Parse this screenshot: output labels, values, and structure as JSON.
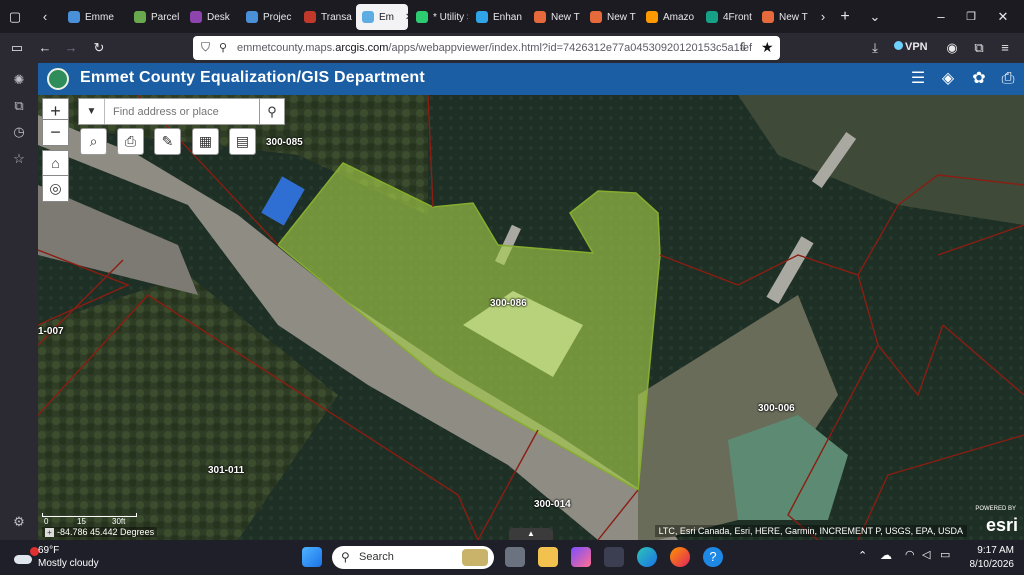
{
  "browser": {
    "tabs": [
      {
        "label": "Emme",
        "color": "#4a90d9"
      },
      {
        "label": "Parcel",
        "color": "#6aa84f"
      },
      {
        "label": "Desk",
        "color": "#8e44ad"
      },
      {
        "label": "Projec",
        "color": "#4a90d9"
      },
      {
        "label": "Transa",
        "color": "#c0392b"
      },
      {
        "label": "Em",
        "color": "#5dade2"
      },
      {
        "label": "* Utility Sh",
        "color": "#2ecc71"
      },
      {
        "label": "Enhan",
        "color": "#2fa4e7"
      },
      {
        "label": "New T",
        "color": "#e66a3c"
      },
      {
        "label": "New T",
        "color": "#e66a3c"
      },
      {
        "label": "Amazo",
        "color": "#ff9900"
      },
      {
        "label": "4Front",
        "color": "#16a085"
      },
      {
        "label": "New T",
        "color": "#e66a3c"
      }
    ],
    "url_prefix": "emmetcounty.maps.",
    "url_host": "arcgis.com",
    "url_path": "/apps/webappviewer/index.html?id=7426312e77a04530920120153c5a1fef",
    "vpn_label": "VPN"
  },
  "app": {
    "title": "Emmet County Equalization/GIS Department",
    "search_placeholder": "Find address or place"
  },
  "map": {
    "parcel_labels": [
      {
        "id": "p-300-085",
        "text": "300-085"
      },
      {
        "id": "p-300-086",
        "text": "300-086"
      },
      {
        "id": "p-1-007",
        "text": "1-007"
      },
      {
        "id": "p-300-006",
        "text": "300-006"
      },
      {
        "id": "p-301-011",
        "text": "301-011"
      },
      {
        "id": "p-300-014",
        "text": "300-014"
      }
    ],
    "scale_labels": [
      "0",
      "15",
      "30ft"
    ],
    "coordinates": "-84.786 45.442 Degrees",
    "attribution": "LTC, Esri Canada, Esri, HERE, Garmin, INCREMENT P, USGS, EPA, USDA",
    "esri_powered": "POWERED BY",
    "esri_logo": "esri",
    "selected_color": "#a8d14a"
  },
  "taskbar": {
    "weather_temp": "69°F",
    "weather_desc": "Mostly cloudy",
    "search_label": "Search",
    "time": "9:17 AM",
    "date": "8/10/2026"
  }
}
